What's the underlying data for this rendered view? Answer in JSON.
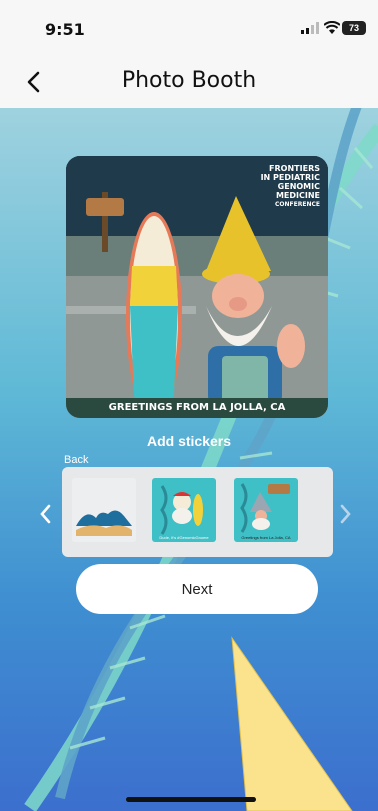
{
  "status_bar": {
    "time": "9:51",
    "battery": "73"
  },
  "header": {
    "title": "Photo Booth"
  },
  "photo": {
    "logo_lines": [
      "FRONTIERS",
      "IN PEDIATRIC",
      "GENOMIC",
      "MEDICINE",
      "CONFERENCE"
    ],
    "caption": "GREETINGS FROM LA JOLLA, CA"
  },
  "stickers_section": {
    "heading": "Add stickers",
    "back_label": "Back",
    "items": [
      {
        "name": "wave",
        "caption": ""
      },
      {
        "name": "surf-dude",
        "caption": "Dude, It's #GenomicGnome"
      },
      {
        "name": "gnome-greeting",
        "caption": "Greetings from La Jolla, CA"
      }
    ]
  },
  "actions": {
    "next_label": "Next"
  },
  "colors": {
    "background_top": "#9fd2df",
    "background_bottom": "#3c6fce",
    "button": "#ffffff",
    "sticker_teal": "#3fbfc6"
  }
}
